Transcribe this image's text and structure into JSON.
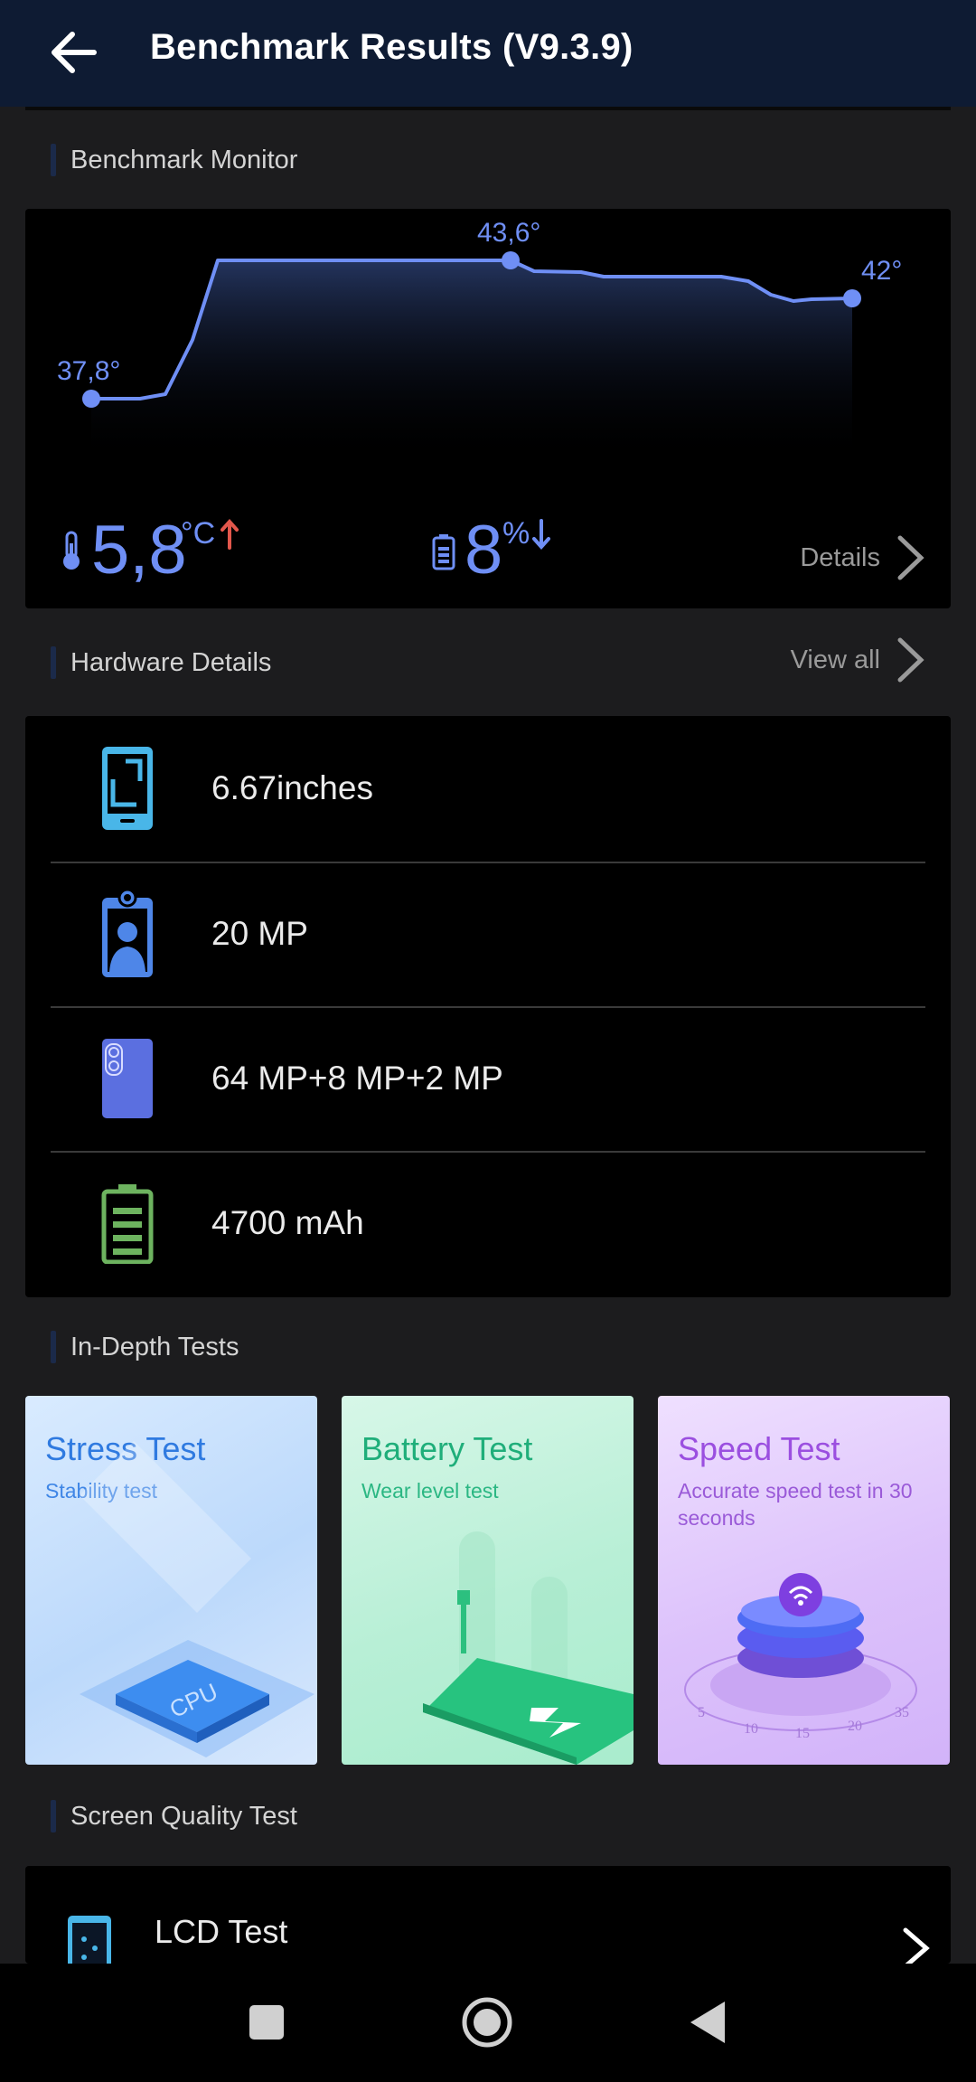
{
  "header": {
    "title": "Benchmark Results (V9.3.9)"
  },
  "monitor": {
    "section_label": "Benchmark Monitor",
    "temp_start_label": "37,8°",
    "temp_peak_label": "43,6°",
    "temp_end_label": "42°",
    "temp_delta": "5,8",
    "temp_unit": "°C",
    "battery_delta": "8",
    "battery_unit": "%",
    "details_label": "Details"
  },
  "chart_data": {
    "type": "area",
    "series": [
      {
        "values": [
          37.8,
          37.8,
          38.0,
          39.5,
          43.6,
          43.6,
          43.6,
          43.6,
          43.6,
          43.2,
          43.2,
          43.0,
          43.0,
          43.0,
          42.7,
          42.0,
          42.1,
          42.0
        ]
      }
    ],
    "annotations": [
      "37,8°",
      "43,6°",
      "42°"
    ],
    "ylim": [
      36,
      45
    ]
  },
  "hardware": {
    "section_label": "Hardware Details",
    "view_all_label": "View all",
    "items": [
      {
        "icon": "phone-screen-icon",
        "text": "6.67inches"
      },
      {
        "icon": "front-camera-icon",
        "text": "20 MP"
      },
      {
        "icon": "rear-camera-icon",
        "text": "64 MP+8 MP+2 MP"
      },
      {
        "icon": "battery-icon",
        "text": "4700 mAh"
      }
    ]
  },
  "indepth": {
    "section_label": "In-Depth Tests",
    "tiles": [
      {
        "title": "Stress Test",
        "subtitle": "Stability test",
        "art_label": "CPU",
        "title_color": "#2f7ae0",
        "sub_color": "#3f86e6"
      },
      {
        "title": "Battery Test",
        "subtitle": "Wear level test",
        "title_color": "#1fae7a",
        "sub_color": "#2bb783"
      },
      {
        "title": "Speed Test",
        "subtitle": "Accurate speed test in 30 seconds",
        "dial_labels": [
          "5",
          "10",
          "15",
          "20",
          "35"
        ],
        "title_color": "#9b4fe0",
        "sub_color": "#9a5ad8"
      }
    ]
  },
  "screen_quality": {
    "section_label": "Screen Quality Test",
    "lcd_label": "LCD Test"
  },
  "colors": {
    "accent": "#6f8ff5",
    "header_bg": "#0e1b33",
    "temp_arrow": "#e2574c"
  }
}
